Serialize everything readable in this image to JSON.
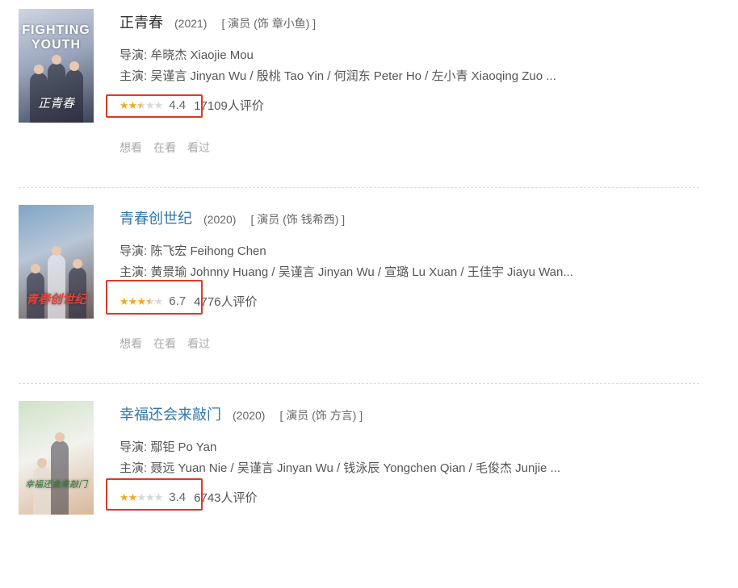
{
  "entries": [
    {
      "title": "正青春",
      "year": "(2021)",
      "role": "[ 演员 (饰 章小鱼) ]",
      "director": "导演: 牟晓杰 Xiaojie Mou",
      "cast": "主演: 吴谨言 Jinyan Wu / 殷桃 Tao Yin / 何润东 Peter Ho / 左小青 Xiaoqing Zuo ...",
      "rating": "4.4",
      "rating_value": 4.4,
      "stars_filled": 2.5,
      "votes": "17109人评价",
      "poster_title": "FIGHTING YOUTH",
      "poster_sub": "正青春",
      "title_color": "#333333"
    },
    {
      "title": "青春创世纪",
      "year": "(2020)",
      "role": "[ 演员 (饰 钱希西) ]",
      "director": "导演: 陈飞宏 Feihong Chen",
      "cast": "主演: 黄景瑜 Johnny Huang / 吴谨言 Jinyan Wu / 宣璐 Lu Xuan / 王佳宇 Jiayu Wan...",
      "rating": "6.7",
      "rating_value": 6.7,
      "stars_filled": 3.5,
      "votes": "4776人评价",
      "poster_title": "",
      "poster_sub": "青春创世纪",
      "title_color": "#3377aa"
    },
    {
      "title": "幸福还会来敲门",
      "year": "(2020)",
      "role": "[ 演员 (饰 方言) ]",
      "director": "导演: 鄢钜 Po Yan",
      "cast": "主演: 聂远 Yuan Nie / 吴谨言 Jinyan Wu / 钱泳辰 Yongchen Qian / 毛俊杰 Junjie ...",
      "rating": "3.4",
      "rating_value": 3.4,
      "stars_filled": 2,
      "votes": "6743人评价",
      "poster_title": "",
      "poster_sub": "幸福还会来敲门",
      "title_color": "#3377aa"
    }
  ],
  "actions": {
    "want": "想看",
    "watching": "在看",
    "watched": "看过"
  },
  "colors": {
    "star_on": "#f5a623",
    "star_off": "#d8d8d8",
    "highlight_box": "#d93a2b",
    "link": "#3377aa"
  }
}
